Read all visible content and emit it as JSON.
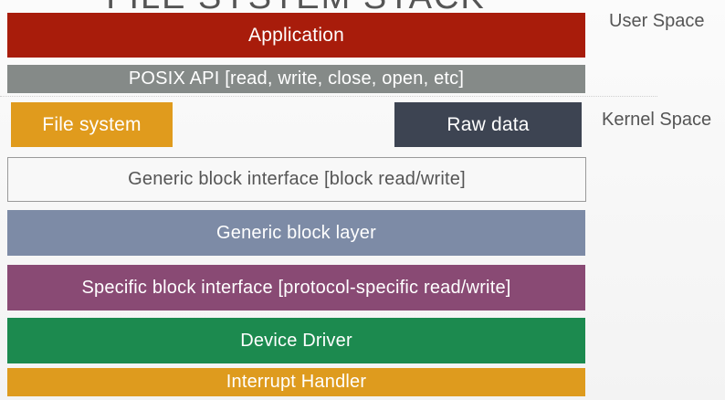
{
  "title": "FILE SYSTEM STACK",
  "labels": {
    "user_space": "User Space",
    "kernel_space": "Kernel Space"
  },
  "layers": {
    "application": "Application",
    "posix": "POSIX API [read, write, close, open, etc]",
    "file_system": "File system",
    "raw_data": "Raw data",
    "generic_interface": "Generic block interface [block read/write]",
    "generic_layer": "Generic block layer",
    "specific_interface": "Specific block interface [protocol-specific read/write]",
    "device_driver": "Device Driver",
    "interrupt_handler": "Interrupt Handler"
  },
  "colors": {
    "application": "#a81c0b",
    "posix": "#858a88",
    "file_system": "#e09b1d",
    "raw_data": "#3d4452",
    "generic_layer": "#7d8ba6",
    "specific_interface": "#894a74",
    "device_driver": "#1c8a4f",
    "interrupt_handler": "#de9b1e"
  }
}
